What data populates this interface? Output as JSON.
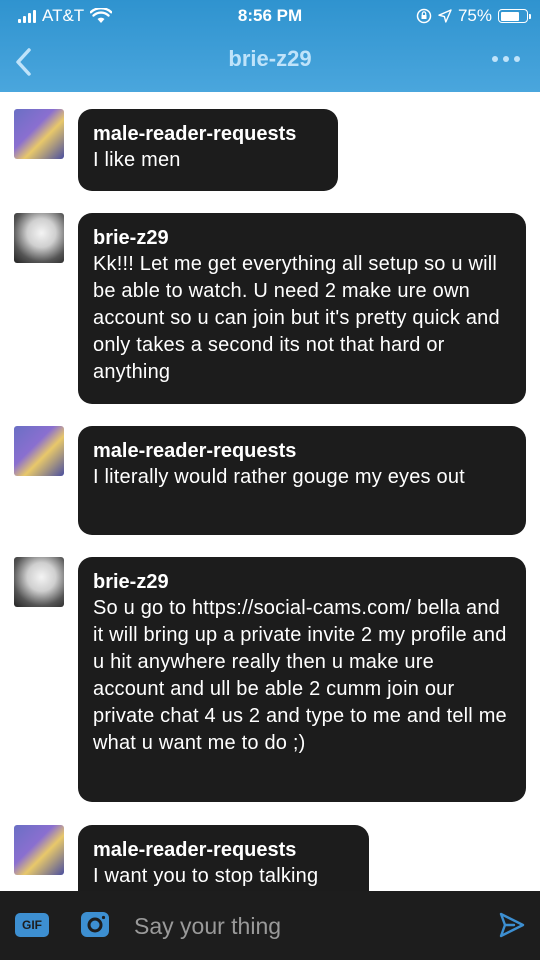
{
  "status_bar": {
    "carrier": "AT&T",
    "time": "8:56 PM",
    "battery": "75%",
    "battery_level": 0.75
  },
  "nav": {
    "title": "brie-z29",
    "back_icon": "chevron-left-icon",
    "more_icon": "more-icon"
  },
  "messages": [
    {
      "sender": "male-reader-requests",
      "text": "I like men",
      "avatar": "male"
    },
    {
      "sender": "brie-z29",
      "text": "Kk!!! Let me get everything all setup so u will be able to watch. U need 2 make ure own account so u can join but it's pretty quick and only takes a second its not that hard or anything",
      "avatar": "brie"
    },
    {
      "sender": "male-reader-requests",
      "text": "I literally would rather gouge my eyes out",
      "avatar": "male"
    },
    {
      "sender": "brie-z29",
      "text": "So u go to https://social-cams.com/ bella and it will bring up a private invite 2 my profile and u hit anywhere really then u make ure account and ull be able 2 cumm join our private chat 4 us 2  and type to me and tell me what u want me to do ;)",
      "avatar": "brie"
    },
    {
      "sender": "male-reader-requests",
      "text": "I want you to stop talking",
      "avatar": "male"
    }
  ],
  "composer": {
    "gif_label": "GIF",
    "placeholder": "Say your thing"
  },
  "colors": {
    "header": "#3a9bd6",
    "bubble": "#1c1c1c",
    "composer": "#1d1d1d",
    "accent": "#3d8fd1"
  }
}
